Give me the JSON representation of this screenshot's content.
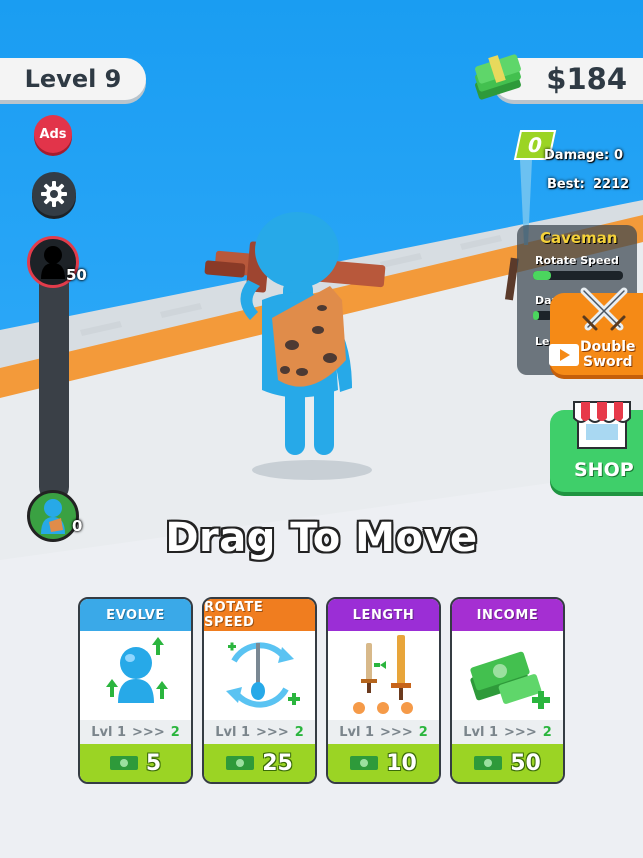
{
  "hud": {
    "level_label": "Level 9",
    "money": "$184"
  },
  "side_buttons": {
    "ads_label": "Ads"
  },
  "progress": {
    "top_value": "50",
    "bottom_value": "0"
  },
  "damage": {
    "badge_value": "0",
    "damage_label": "Damage:",
    "damage_value": "0",
    "best_label": "Best:",
    "best_value": "2212"
  },
  "enemy_panel": {
    "name": "Caveman",
    "stat1_label": "Rotate Speed",
    "stat2_label": "Dama",
    "stat3_label": "Le"
  },
  "double_sword": {
    "line1": "Double",
    "line2": "Sword"
  },
  "shop": {
    "label": "SHOP"
  },
  "hint": "Drag To Move",
  "cards": [
    {
      "title": "EVOLVE",
      "header_color": "#3aa9e8",
      "level_text": "Lvl",
      "level_from": "1",
      "arrows": ">>>",
      "level_to": "2",
      "price": "5"
    },
    {
      "title": "ROTATE SPEED",
      "header_color": "#f07d1f",
      "level_text": "Lvl",
      "level_from": "1",
      "arrows": ">>>",
      "level_to": "2",
      "price": "25"
    },
    {
      "title": "LENGTH",
      "header_color": "#9b2ed6",
      "level_text": "Lvl",
      "level_from": "1",
      "arrows": ">>>",
      "level_to": "2",
      "price": "10"
    },
    {
      "title": "INCOME",
      "header_color": "#a52fd2",
      "level_text": "Lvl",
      "level_from": "1",
      "arrows": ">>>",
      "level_to": "2",
      "price": "50"
    }
  ]
}
